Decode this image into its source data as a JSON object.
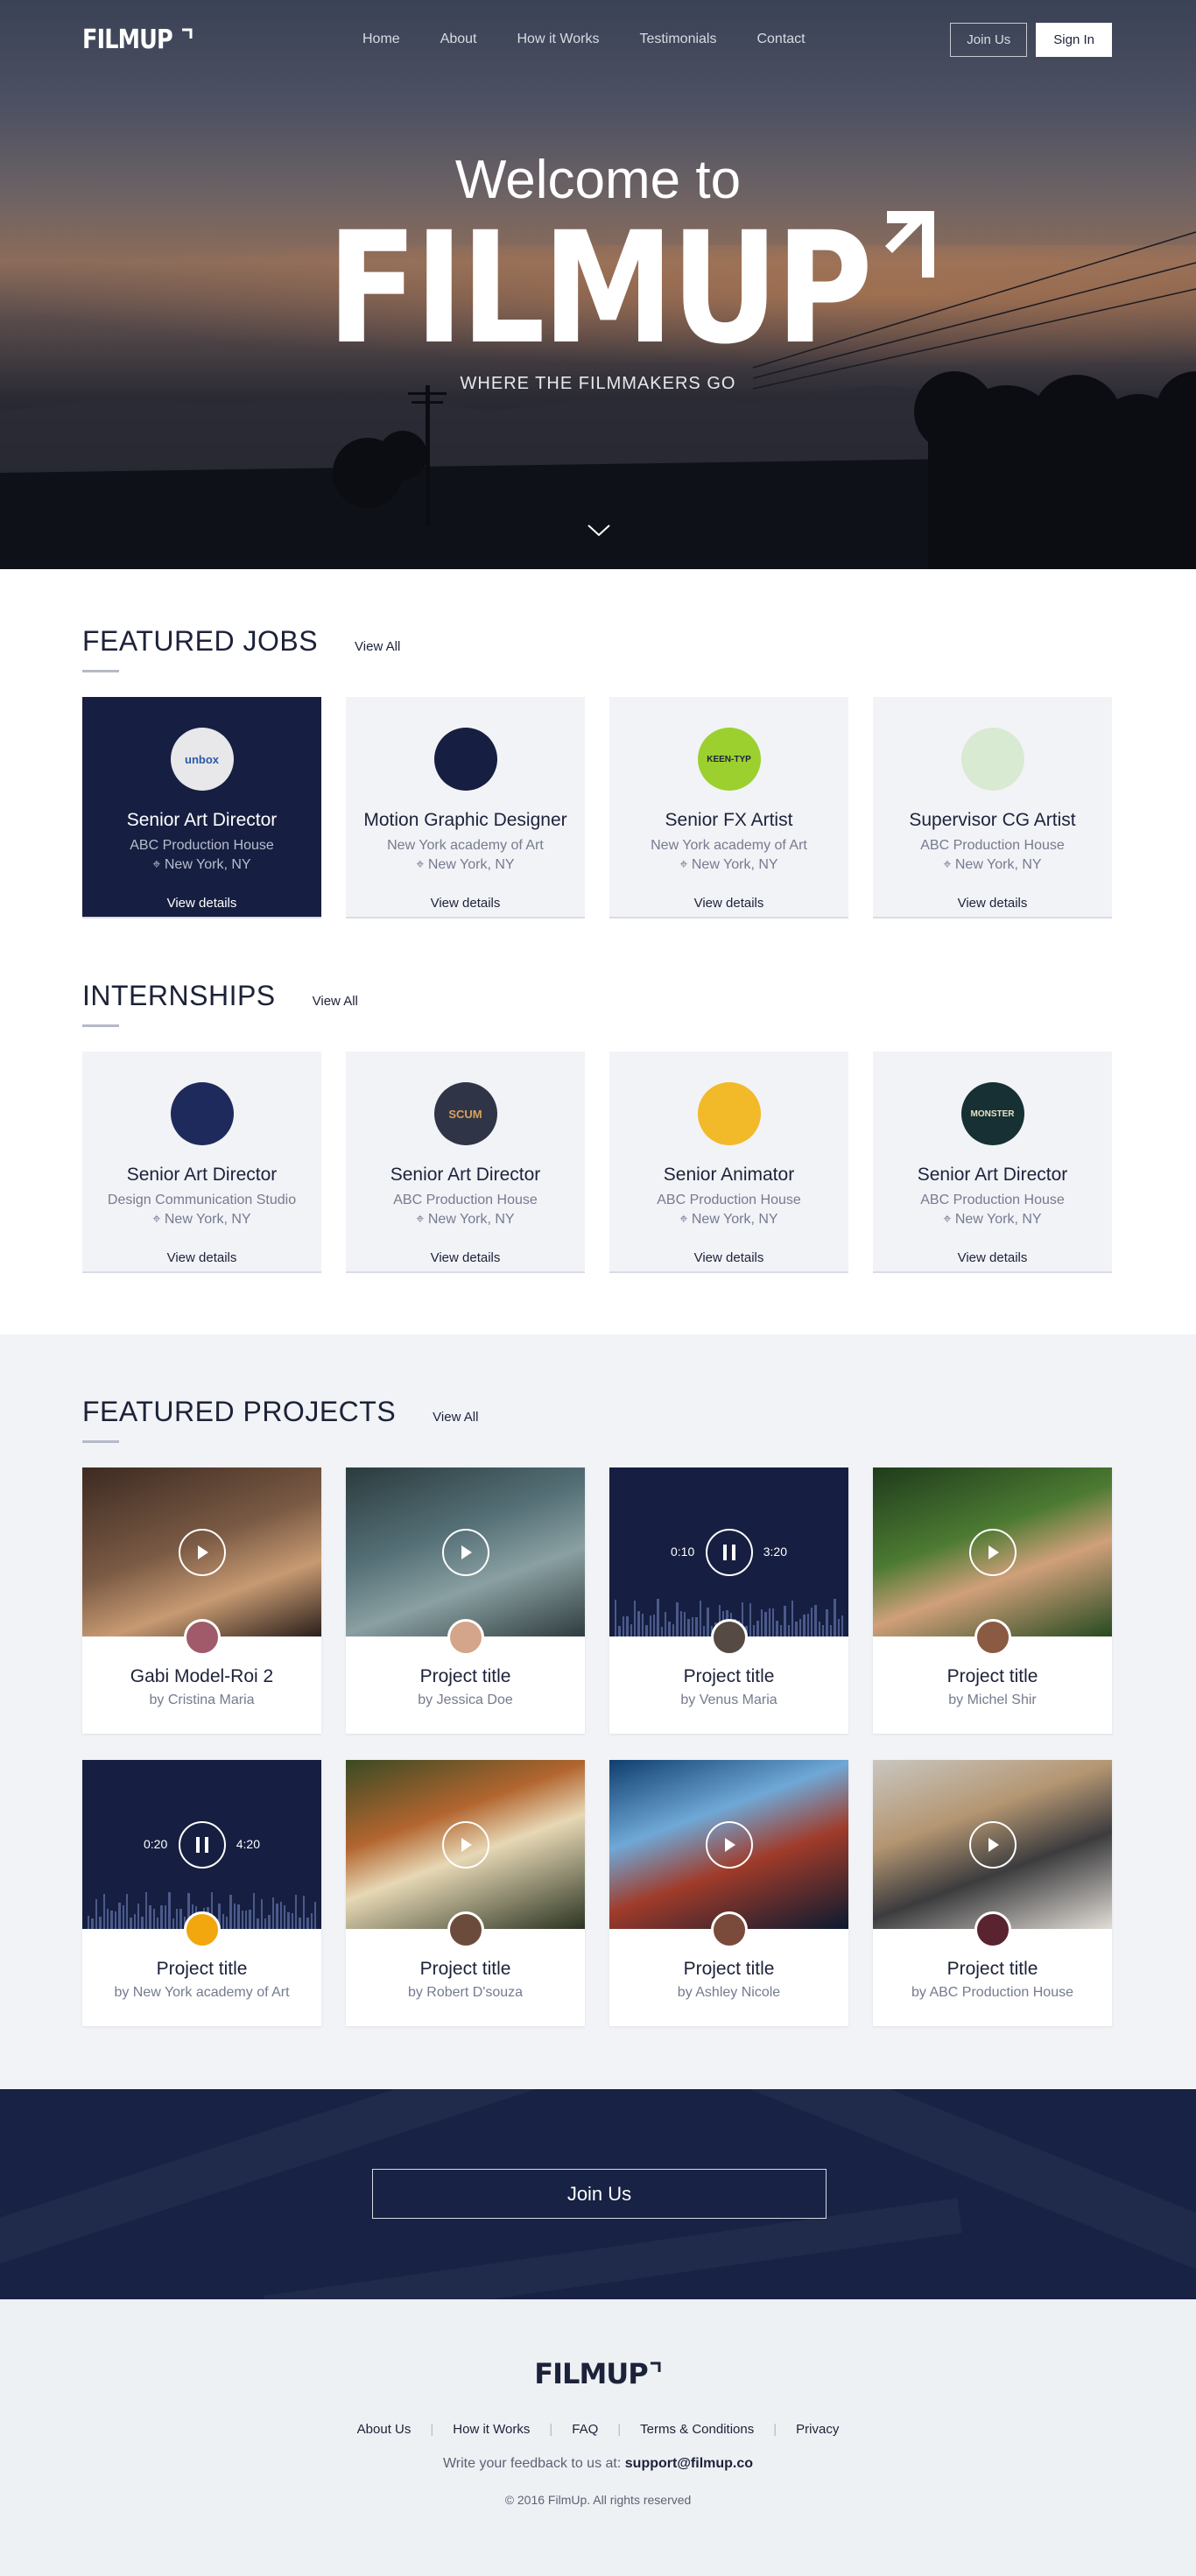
{
  "brand": {
    "name": "FILMUP"
  },
  "nav": {
    "links": [
      "Home",
      "About",
      "How it Works",
      "Testimonials",
      "Contact"
    ],
    "join_label": "Join Us",
    "signin_label": "Sign In"
  },
  "hero": {
    "welcome": "Welcome to",
    "brand": "FILMUP",
    "tagline": "WHERE THE FILMMAKERS GO"
  },
  "featured_jobs": {
    "title": "FEATURED JOBS",
    "view_all": "View All",
    "cards": [
      {
        "title": "Senior Art Director",
        "company": "ABC Production House",
        "location": "New York, NY",
        "details": "View details",
        "logo_text": "unbox",
        "logo_bg": "#e8e8ea",
        "logo_fg": "#2a58a8"
      },
      {
        "title": "Motion Graphic Designer",
        "company": "New York academy of Art",
        "location": "New York, NY",
        "details": "View details",
        "logo_text": "",
        "logo_bg": "#161f41",
        "logo_fg": "#e7b530"
      },
      {
        "title": "Senior FX Artist",
        "company": "New York academy of Art",
        "location": "New York, NY",
        "details": "View details",
        "logo_text": "KEEN-TYP",
        "logo_bg": "#9bd02f",
        "logo_fg": "#1c2239"
      },
      {
        "title": "Supervisor CG Artist",
        "company": "ABC Production House",
        "location": "New York, NY",
        "details": "View details",
        "logo_text": "",
        "logo_bg": "#d9ead2",
        "logo_fg": "#9e2b24"
      }
    ]
  },
  "internships": {
    "title": "INTERNSHIPS",
    "view_all": "View All",
    "cards": [
      {
        "title": "Senior Art Director",
        "company": "Design Communication Studio",
        "location": "New York, NY",
        "details": "View details",
        "logo_text": "",
        "logo_bg": "#1f2a5c",
        "logo_fg": "#7fc5f0"
      },
      {
        "title": "Senior Art Director",
        "company": "ABC Production House",
        "location": "New York, NY",
        "details": "View details",
        "logo_text": "SCUM",
        "logo_bg": "#2f3547",
        "logo_fg": "#d9a15a"
      },
      {
        "title": "Senior Animator",
        "company": "ABC Production House",
        "location": "New York, NY",
        "details": "View details",
        "logo_text": "",
        "logo_bg": "#f2b928",
        "logo_fg": "#c2421d"
      },
      {
        "title": "Senior Art Director",
        "company": "ABC Production House",
        "location": "New York, NY",
        "details": "View details",
        "logo_text": "MONSTER",
        "logo_bg": "#163033",
        "logo_fg": "#e8e2c5"
      }
    ]
  },
  "projects": {
    "title": "FEATURED PROJECTS",
    "view_all": "View All",
    "cards": [
      {
        "title": "Gabi Model-Roi 2",
        "by": "by Cristina Maria",
        "media": "photo",
        "bg": "linear-gradient(160deg,#3c2a22 0%,#7a5a44 45%,#c79a72 70%,#2a1f1b 100%)",
        "avatar": "#a05a6a",
        "playing": false
      },
      {
        "title": "Project title",
        "by": "by Jessica Doe",
        "media": "photo",
        "bg": "linear-gradient(160deg,#2b3b3e 0%,#557077 40%,#8aa0a2 65%,#2f3c3f 100%)",
        "avatar": "#d4a58a",
        "playing": false
      },
      {
        "title": "Project title",
        "by": "by Venus Maria",
        "media": "audio",
        "bg": "#161f41",
        "avatar": "#554a44",
        "playing": true,
        "t_start": "0:10",
        "t_end": "3:20"
      },
      {
        "title": "Project title",
        "by": "by Michel Shir",
        "media": "photo",
        "bg": "linear-gradient(160deg,#1f3b1c 0%,#4c7a32 40%,#d0a07a 62%,#264a20 100%)",
        "avatar": "#8a5a42",
        "playing": false
      },
      {
        "title": "Project title",
        "by": "by New York academy of Art",
        "media": "audio",
        "bg": "#161f41",
        "avatar": "#f2a70f",
        "playing": true,
        "t_start": "0:20",
        "t_end": "4:20"
      },
      {
        "title": "Project title",
        "by": "by Robert D'souza",
        "media": "photo",
        "bg": "linear-gradient(160deg,#3a4a24 0%,#b2652f 35%,#e7d8b5 55%,#2b3422 100%)",
        "avatar": "#6b4c3c",
        "playing": false
      },
      {
        "title": "Project title",
        "by": "by Ashley Nicole",
        "media": "photo",
        "bg": "linear-gradient(160deg,#0f3d6e 0%,#6fa8d6 35%,#a03b2a 60%,#0b1a30 100%)",
        "avatar": "#7a4a3a",
        "playing": false
      },
      {
        "title": "Project title",
        "by": "by ABC Production House",
        "media": "photo",
        "bg": "linear-gradient(160deg,#c9c6c0 0%,#b49672 35%,#3c3c3e 62%,#e2ddd6 100%)",
        "avatar": "#5a2330",
        "playing": false
      }
    ]
  },
  "join_band": {
    "button": "Join Us"
  },
  "footer": {
    "logo": "FILMUP",
    "links": [
      "About Us",
      "How it Works",
      "FAQ",
      "Terms & Conditions",
      "Privacy"
    ],
    "feedback_prefix": "Write your feedback to us at: ",
    "email": "support@filmup.co",
    "copyright": "© 2016 FilmUp. All rights reserved"
  }
}
